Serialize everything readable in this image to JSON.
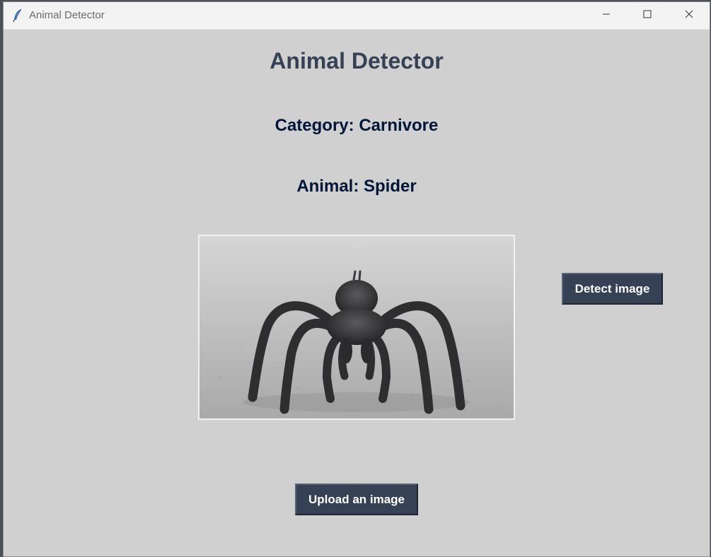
{
  "window": {
    "title": "Animal Detector",
    "app_icon": "feather-icon",
    "controls": [
      "minimize-icon",
      "maximize-icon",
      "close-icon"
    ]
  },
  "main": {
    "heading": "Animal Detector",
    "category_text": "Category: Carnivore",
    "animal_text": "Animal: Spider",
    "image": {
      "subject": "spider",
      "description": "Tarantula on gravel ground"
    },
    "detect_button": "Detect image",
    "upload_button": "Upload an image"
  },
  "colors": {
    "background": "#d0d0d0",
    "heading": "#364156",
    "labels": "#011638",
    "button": "#364156",
    "button_text": "#ffffff"
  }
}
